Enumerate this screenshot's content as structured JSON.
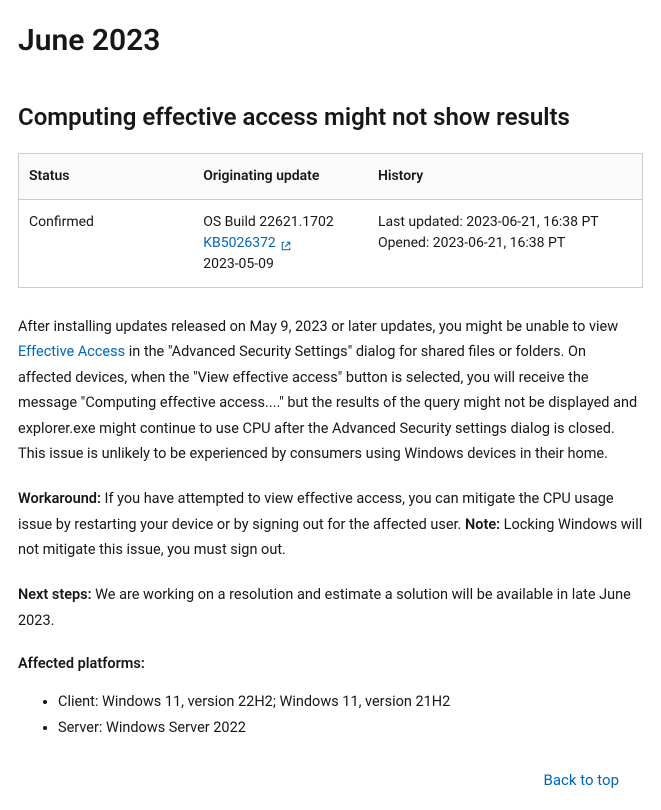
{
  "page": {
    "month_title": "June 2023",
    "issue_title": "Computing effective access might not show results"
  },
  "table": {
    "headers": {
      "status": "Status",
      "update": "Originating update",
      "history": "History"
    },
    "row": {
      "status": "Confirmed",
      "update_build": "OS Build 22621.1702",
      "update_kb": "KB5026372",
      "update_date": "2023-05-09",
      "history_updated": "Last updated: 2023-06-21, 16:38 PT",
      "history_opened": "Opened: 2023-06-21, 16:38 PT"
    }
  },
  "body": {
    "intro_pre": "After installing updates released on May 9, 2023 or later updates, you might be unable to view ",
    "intro_link": "Effective Access",
    "intro_post": " in the \"Advanced Security Settings\" dialog for shared files or folders. On affected devices, when the \"View effective access\" button is selected, you will receive the message \"Computing effective access....\" but the results of the query might not be displayed and explorer.exe might continue to use CPU after the Advanced Security settings dialog is closed. This issue is unlikely to be experienced by consumers using Windows devices in their home.",
    "workaround_label": "Workaround:",
    "workaround_text": " If you have attempted to view effective access, you can mitigate the CPU usage issue by restarting your device or by signing out for the affected user. ",
    "workaround_note_label": "Note:",
    "workaround_note_text": " Locking Windows will not mitigate this issue, you must sign out.",
    "nextsteps_label": "Next steps:",
    "nextsteps_text": " We are working on a resolution and estimate a solution will be available in late June 2023.",
    "affected_label": "Affected platforms:",
    "platform_client": "Client: Windows 11, version 22H2; Windows 11, version 21H2",
    "platform_server": "Server: Windows Server 2022"
  },
  "nav": {
    "back_to_top": "Back to top"
  }
}
